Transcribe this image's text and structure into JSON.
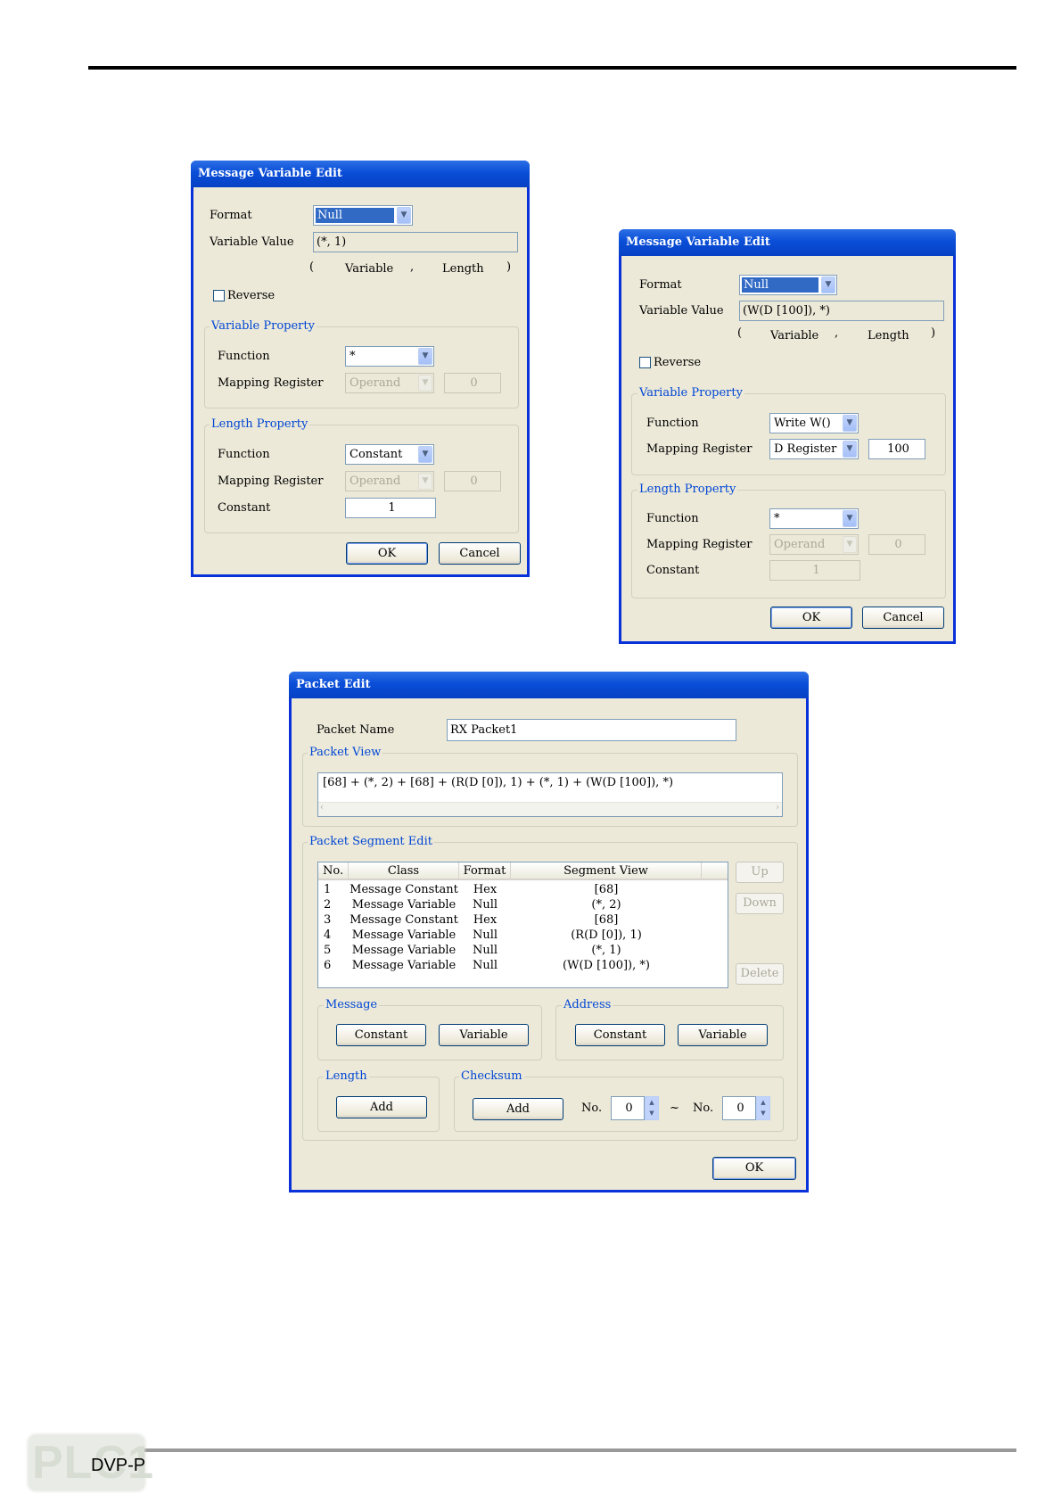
{
  "footer": {
    "text": "DVP-P",
    "logo_text": "PLC1"
  },
  "dialog1": {
    "title": "Message Variable Edit",
    "format_label": "Format",
    "format_value": "Null",
    "variable_value_label": "Variable Value",
    "variable_value": "(*, 1)",
    "hint_open": "(",
    "hint_variable": "Variable",
    "hint_comma": ",",
    "hint_length": "Length",
    "hint_close": ")",
    "reverse_label": "Reverse",
    "var_prop_title": "Variable Property",
    "var_function_label": "Function",
    "var_function_value": "*",
    "var_mapping_label": "Mapping Register",
    "var_mapping_value": "Operand",
    "var_mapping_number": "0",
    "len_prop_title": "Length Property",
    "len_function_label": "Function",
    "len_function_value": "Constant",
    "len_mapping_label": "Mapping Register",
    "len_mapping_value": "Operand",
    "len_mapping_number": "0",
    "constant_label": "Constant",
    "constant_value": "1",
    "ok": "OK",
    "cancel": "Cancel"
  },
  "dialog2": {
    "title": "Message Variable Edit",
    "format_label": "Format",
    "format_value": "Null",
    "variable_value_label": "Variable Value",
    "variable_value": "(W(D [100]), *)",
    "hint_open": "(",
    "hint_variable": "Variable",
    "hint_comma": ",",
    "hint_length": "Length",
    "hint_close": ")",
    "reverse_label": "Reverse",
    "var_prop_title": "Variable Property",
    "var_function_label": "Function",
    "var_function_value": "Write W()",
    "var_mapping_label": "Mapping Register",
    "var_mapping_value": "D Register",
    "var_mapping_number": "100",
    "len_prop_title": "Length Property",
    "len_function_label": "Function",
    "len_function_value": "*",
    "len_mapping_label": "Mapping Register",
    "len_mapping_value": "Operand",
    "len_mapping_number": "0",
    "constant_label": "Constant",
    "constant_value": "1",
    "ok": "OK",
    "cancel": "Cancel"
  },
  "packet": {
    "title": "Packet Edit",
    "name_label": "Packet Name",
    "name_value": "RX Packet1",
    "view_title": "Packet View",
    "view_text": "[68] + (*, 2) + [68] + (R(D [0]), 1) + (*, 1) + (W(D [100]), *)",
    "segment_title": "Packet Segment Edit",
    "columns": [
      "No.",
      "Class",
      "Format",
      "Segment View"
    ],
    "rows": [
      [
        "1",
        "Message Constant",
        "Hex",
        "[68]"
      ],
      [
        "2",
        "Message Variable",
        "Null",
        "(*, 2)"
      ],
      [
        "3",
        "Message Constant",
        "Hex",
        "[68]"
      ],
      [
        "4",
        "Message Variable",
        "Null",
        "(R(D [0]), 1)"
      ],
      [
        "5",
        "Message Variable",
        "Null",
        "(*, 1)"
      ],
      [
        "6",
        "Message Variable",
        "Null",
        "(W(D [100]), *)"
      ]
    ],
    "up": "Up",
    "down": "Down",
    "delete": "Delete",
    "message_title": "Message",
    "message_constant": "Constant",
    "message_variable": "Variable",
    "address_title": "Address",
    "address_constant": "Constant",
    "address_variable": "Variable",
    "length_title": "Length",
    "length_add": "Add",
    "checksum_title": "Checksum",
    "checksum_add": "Add",
    "no_label": "No.",
    "no_from": "0",
    "tilde": "~",
    "no_label2": "No.",
    "no_to": "0",
    "ok": "OK"
  }
}
